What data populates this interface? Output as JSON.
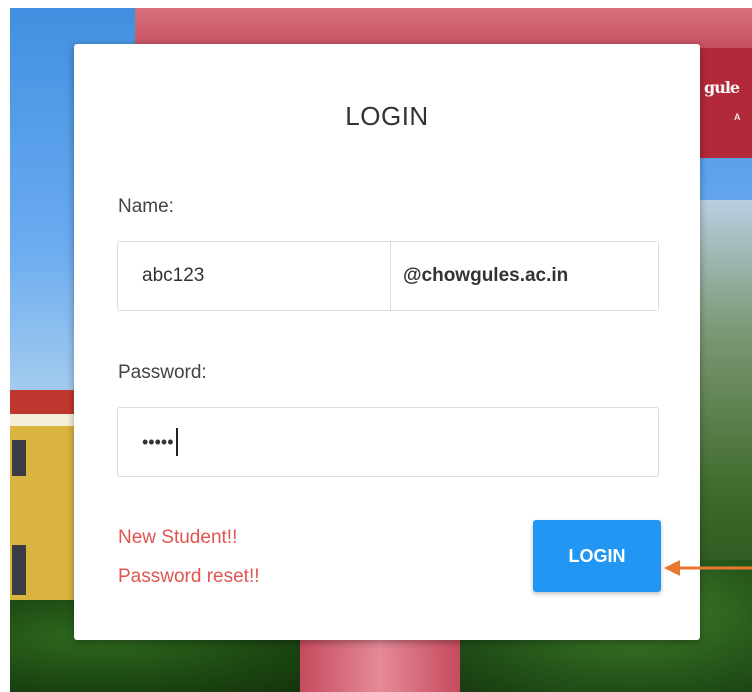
{
  "login_card": {
    "title": "LOGIN",
    "name_label": "Name:",
    "name_value": "abc123",
    "email_domain": "@chowgules.ac.in",
    "password_label": "Password:",
    "password_mask": "•••••",
    "new_student_link": "New Student!!",
    "password_reset_link": "Password reset!!",
    "login_button": "LOGIN"
  },
  "background": {
    "gate_text": "gule",
    "gate_subtext": "A"
  },
  "colors": {
    "button_blue": "#2196f3",
    "link_red": "#e05551",
    "arrow_orange": "#e8782d"
  }
}
